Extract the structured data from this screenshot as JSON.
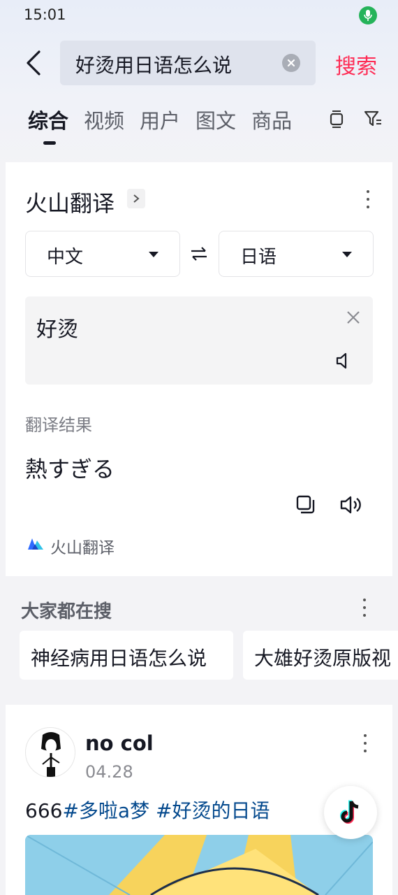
{
  "status_bar": {
    "time": "15:01",
    "mic_icon": "microphone-icon",
    "mic_color": "#25b35a"
  },
  "search": {
    "query": "好烫用日语怎么说",
    "submit_label": "搜索",
    "accent": "#fe2c55"
  },
  "tabs": [
    {
      "label": "综合",
      "active": true
    },
    {
      "label": "视频"
    },
    {
      "label": "用户"
    },
    {
      "label": "图文"
    },
    {
      "label": "商品"
    }
  ],
  "translator": {
    "title": "火山翻译",
    "source_lang": "中文",
    "target_lang": "日语",
    "input_text": "好烫",
    "result_label": "翻译结果",
    "result_text": "熱すぎる",
    "brand_name": "火山翻译"
  },
  "trending": {
    "title": "大家都在搜",
    "items": [
      "神经病用日语怎么说",
      "大雄好烫原版视"
    ]
  },
  "post": {
    "username": "no col",
    "date": "04.28",
    "text_prefix": "666",
    "hashtags": [
      "#多啦a梦",
      "#好烫的日语"
    ],
    "hashtag_color": "#04498d"
  }
}
